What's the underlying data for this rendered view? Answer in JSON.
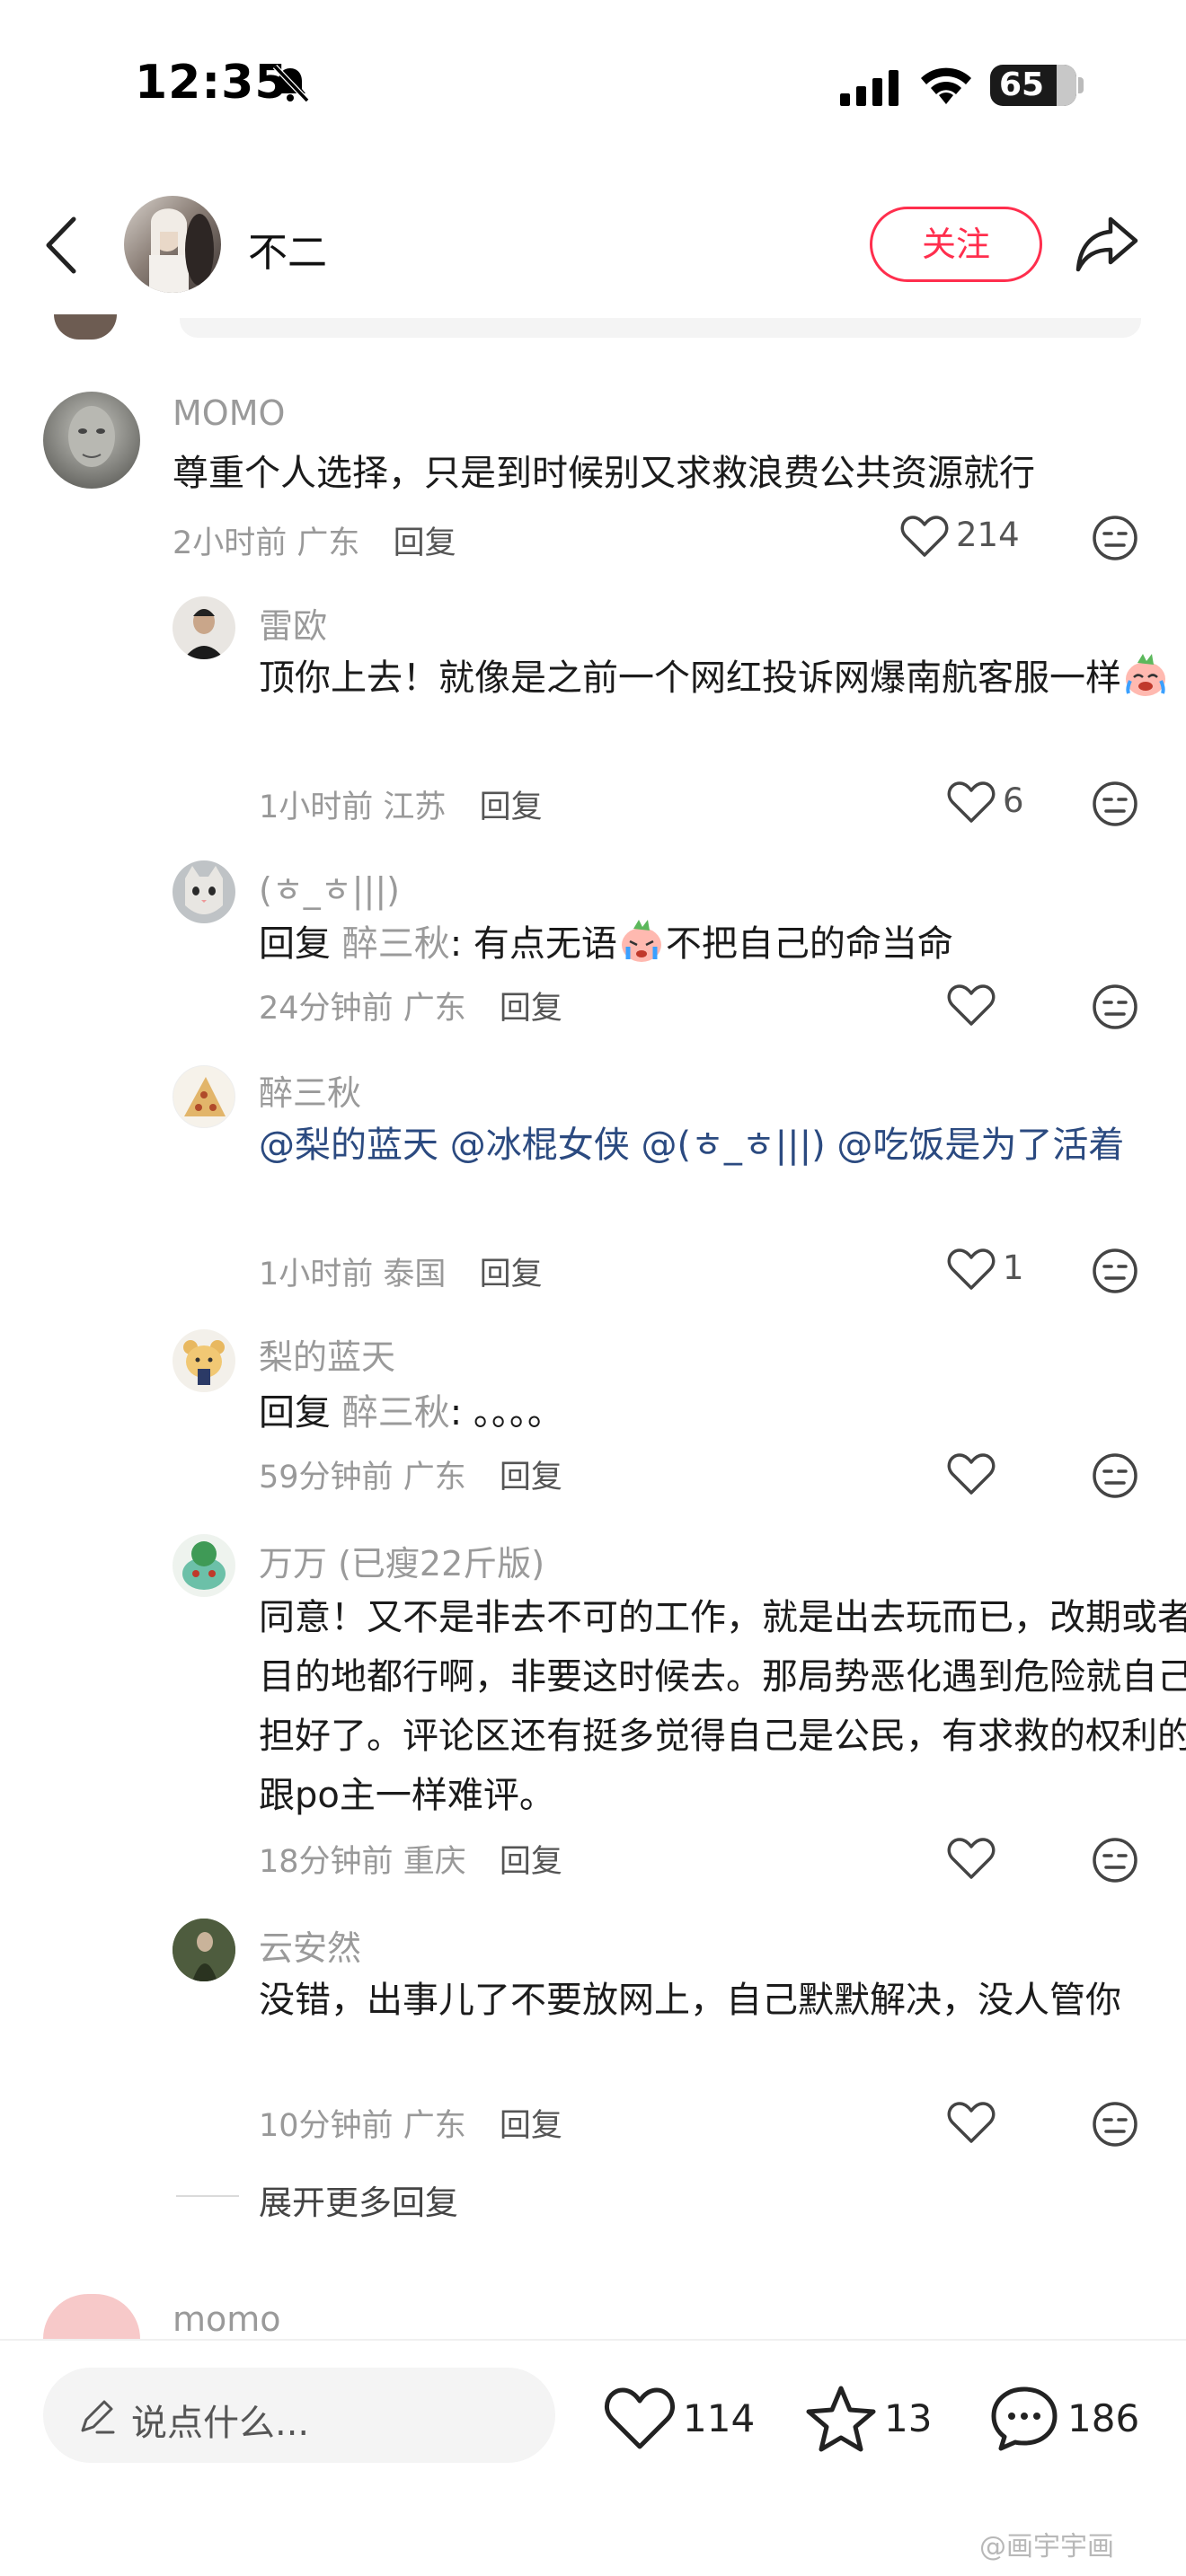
{
  "status_bar": {
    "time": "12:35",
    "battery": "65"
  },
  "header": {
    "name": "不二",
    "follow_label": "关注"
  },
  "comment": {
    "username": "MOMO",
    "text": "尊重个人选择，只是到时候别又求救浪费公共资源就行",
    "time": "2小时前",
    "location": "广东",
    "reply_label": "回复",
    "likes": "214"
  },
  "replies": [
    {
      "username": "雷欧",
      "text_before": "顶你上去！就像是之前一个网红投诉网爆南航客服一样",
      "time": "1小时前",
      "location": "江苏",
      "reply_label": "回复",
      "likes": "6"
    },
    {
      "username": "(ㅎ_ㅎ|||)",
      "prefix": "回复",
      "reply_to": "醉三秋",
      "text_before": ": 有点无语",
      "text_after": "不把自己的命当命",
      "time": "24分钟前",
      "location": "广东",
      "reply_label": "回复",
      "likes": ""
    },
    {
      "username": "醉三秋",
      "mentions": [
        "@梨的蓝天",
        "@冰棍女侠",
        "@(ㅎ_ㅎ|||)",
        "@吃饭是为了活着"
      ],
      "time": "1小时前",
      "location": "泰国",
      "reply_label": "回复",
      "likes": "1"
    },
    {
      "username": "梨的蓝天",
      "prefix": "回复",
      "reply_to": "醉三秋",
      "text_before": ": 。。。。",
      "time": "59分钟前",
      "location": "广东",
      "reply_label": "回复",
      "likes": ""
    },
    {
      "username": "万万 (已瘦22斤版)",
      "text_before": "同意！又不是非去不可的工作，就是出去玩而已，改期或者改目的地都行啊，非要这时候去。那局势恶化遇到危险就自己承担好了。评论区还有挺多觉得自己是公民，有求救的权利的，跟po主一样难评。",
      "time": "18分钟前",
      "location": "重庆",
      "reply_label": "回复",
      "likes": ""
    },
    {
      "username": "云安然",
      "text_before": "没错，出事儿了不要放网上，自己默默解决，没人管你",
      "time": "10分钟前",
      "location": "广东",
      "reply_label": "回复",
      "likes": ""
    }
  ],
  "expand_more": "展开更多回复",
  "next_comment": {
    "username": "momo"
  },
  "bottom_bar": {
    "placeholder": "说点什么...",
    "likes": "114",
    "favorites": "13",
    "comments": "186"
  },
  "watermark": "@画宇宇画",
  "colors": {
    "accent": "#ff2e4d",
    "mention": "#2b4a80",
    "meta": "#999999"
  }
}
